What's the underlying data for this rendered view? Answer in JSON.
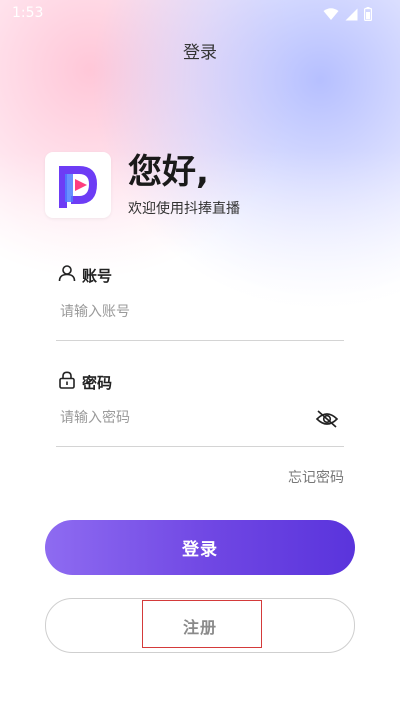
{
  "status_bar": {
    "time": "1:53",
    "icons": [
      "wifi-icon",
      "cellular-icon",
      "battery-icon"
    ]
  },
  "header": {
    "title": "登录"
  },
  "brand": {
    "logo_icon": "app-logo-icon",
    "greeting": "您好,",
    "subtitle": "欢迎使用抖捧直播"
  },
  "form": {
    "account": {
      "label": "账号",
      "placeholder": "请输入账号",
      "value": "",
      "icon": "user-icon"
    },
    "password": {
      "label": "密码",
      "placeholder": "请输入密码",
      "value": "",
      "icon": "lock-icon",
      "toggle_icon": "eye-off-icon"
    },
    "forgot_label": "忘记密码"
  },
  "actions": {
    "login_label": "登录",
    "register_label": "注册"
  },
  "colors": {
    "primary_start": "#8e6bf1",
    "primary_end": "#5a34dc",
    "highlight": "#d43a3a",
    "logo_purple": "#6d3cf5",
    "logo_pink": "#ff3d7f"
  }
}
